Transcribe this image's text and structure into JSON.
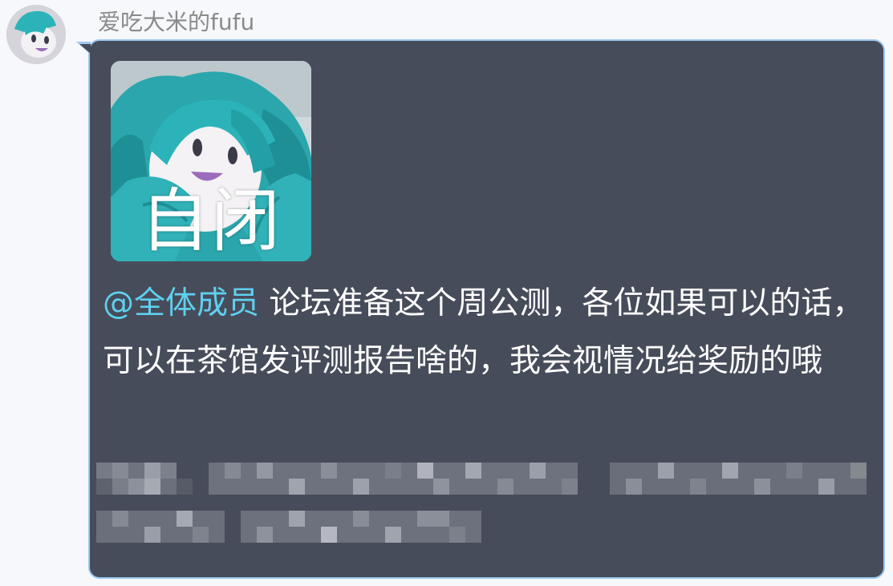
{
  "sender": {
    "name": "爱吃大米的fufu"
  },
  "message": {
    "sticker_caption": "自闭",
    "mention": "@全体成员",
    "text": " 论坛准备这个周公测，各位如果可以的话，可以在茶馆发评测报告啥的，我会视情况给奖励的哦"
  },
  "colors": {
    "bubble_bg": "#474c5a",
    "bubble_border": "#9cc7ee",
    "mention": "#5fd0ee",
    "sender_name": "#8a8a8a",
    "page_bg": "#f6f8fb"
  }
}
